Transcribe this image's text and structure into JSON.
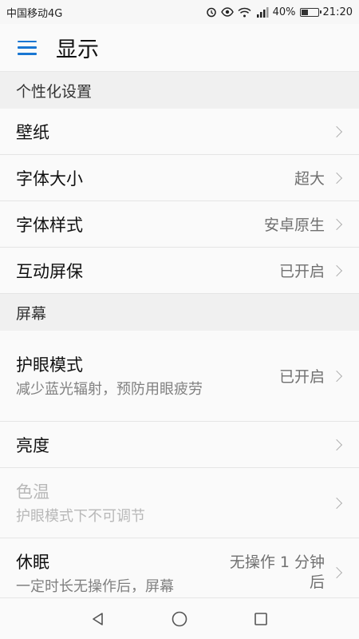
{
  "status_bar": {
    "carrier": "中国移动4G",
    "network_type": "4G",
    "battery": "40%",
    "battery_level": 0.4,
    "time": "21:20",
    "icons": [
      "alarm-icon",
      "eye-icon",
      "wifi-icon",
      "signal-icon",
      "battery-icon"
    ]
  },
  "header": {
    "menu_icon": "menu-icon",
    "title": "显示"
  },
  "sections": [
    {
      "header": "个性化设置",
      "items": [
        {
          "title": "壁纸",
          "value": ""
        },
        {
          "title": "字体大小",
          "value": "超大"
        },
        {
          "title": "字体样式",
          "value": "安卓原生"
        },
        {
          "title": "互动屏保",
          "value": "已开启"
        }
      ]
    },
    {
      "header": "屏幕",
      "items": [
        {
          "title": "护眼模式",
          "subtitle": "减少蓝光辐射，预防用眼疲劳",
          "value": "已开启"
        },
        {
          "title": "亮度",
          "value": ""
        },
        {
          "title": "色温",
          "subtitle": "护眼模式下不可调节",
          "value": "",
          "disabled": true
        },
        {
          "title": "休眠",
          "subtitle": "一定时长无操作后，屏幕",
          "value": "无操作 1 分钟后"
        }
      ]
    }
  ],
  "nav_bar": {
    "back": "back-icon",
    "home": "home-icon",
    "recents": "recents-icon"
  },
  "colors": {
    "accent": "#1976d2",
    "background": "#fafafa",
    "section_bg": "#f0f0f0"
  }
}
